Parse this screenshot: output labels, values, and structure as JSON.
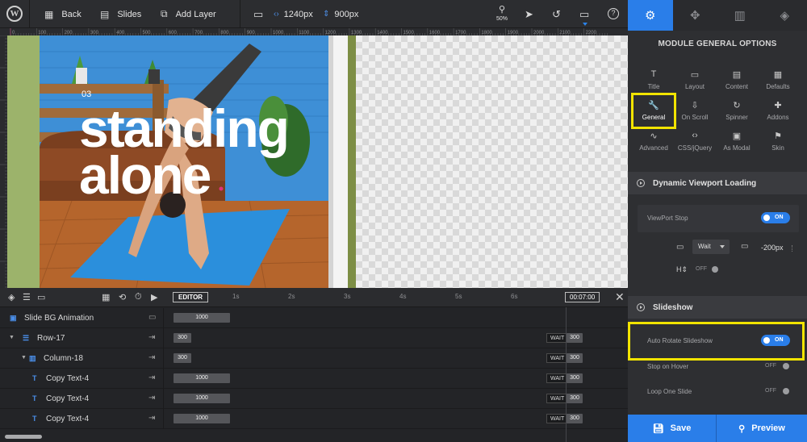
{
  "toolbar": {
    "wp_logo": "W",
    "back_label": "Back",
    "slides_label": "Slides",
    "add_layer_label": "Add Layer",
    "width_value": "1240px",
    "height_value": "900px",
    "zoom_label": "50%",
    "icons": [
      "wordpress-icon",
      "grid-icon",
      "slides-icon",
      "add-layer-icon",
      "monitor-icon",
      "width-arrows-icon",
      "height-arrows-icon",
      "search-icon",
      "cursor-icon",
      "undo-icon",
      "desktop-icon",
      "help-icon"
    ]
  },
  "right_panel": {
    "tabs": [
      {
        "icon": "gear-icon",
        "active": true
      },
      {
        "icon": "move-icon",
        "active": false
      },
      {
        "icon": "slides-grid-icon",
        "active": false
      },
      {
        "icon": "layers-icon",
        "active": false
      }
    ],
    "title": "MODULE GENERAL OPTIONS",
    "modules": [
      {
        "label": "Title",
        "glyph": "T"
      },
      {
        "label": "Layout",
        "glyph": "▭"
      },
      {
        "label": "Content",
        "glyph": "▤"
      },
      {
        "label": "Defaults",
        "glyph": "▦"
      },
      {
        "label": "General",
        "glyph": "🔧"
      },
      {
        "label": "On Scroll",
        "glyph": "⇩"
      },
      {
        "label": "Spinner",
        "glyph": "↻"
      },
      {
        "label": "Addons",
        "glyph": "✚"
      },
      {
        "label": "Advanced",
        "glyph": "∿"
      },
      {
        "label": "CSS/jQuery",
        "glyph": "‹›"
      },
      {
        "label": "As Modal",
        "glyph": "▣"
      },
      {
        "label": "Skin",
        "glyph": "⚑"
      }
    ],
    "dynamic_viewport": {
      "heading": "Dynamic Viewport Loading",
      "viewport_stop_label": "ViewPort Stop",
      "viewport_stop_value": "ON",
      "wait_select": "Wait",
      "offset_value": "-200px",
      "secondary_toggle": "OFF"
    },
    "slideshow": {
      "heading": "Slideshow",
      "auto_rotate_label": "Auto Rotate Slideshow",
      "auto_rotate_value": "ON",
      "stop_on_hover_label": "Stop on Hover",
      "stop_on_hover_value": "OFF",
      "loop_one_slide_label": "Loop One Slide",
      "loop_one_slide_value": "OFF"
    },
    "save_label": "Save",
    "preview_label": "Preview"
  },
  "ruler": {
    "marks": [
      "0",
      "100",
      "200",
      "300",
      "400",
      "500",
      "600",
      "700",
      "800",
      "900",
      "1000",
      "1100",
      "1200",
      "1300",
      "1400",
      "1500",
      "1600",
      "1700",
      "1800",
      "1900",
      "2000",
      "2100",
      "2200"
    ]
  },
  "slide": {
    "number": "03",
    "headline_line1": "standing",
    "headline_line2": "alone"
  },
  "timeline": {
    "editor_label": "EDITOR",
    "seconds": [
      "1s",
      "2s",
      "3s",
      "4s",
      "5s",
      "6s"
    ],
    "total_time": "00:07:00",
    "rows": [
      {
        "name": "Slide BG Animation",
        "bar": "1000",
        "wait": ""
      },
      {
        "name": "Row-17",
        "bar": "300",
        "wait": "WAIT",
        "wait_value": "300"
      },
      {
        "name": "Column-18",
        "bar": "300",
        "wait": "WAIT",
        "wait_value": "300"
      },
      {
        "name": "Copy Text-4",
        "bar": "1000",
        "wait": "WAIT",
        "wait_value": "300"
      },
      {
        "name": "Copy Text-4",
        "bar": "1000",
        "wait": "WAIT",
        "wait_value": "300"
      },
      {
        "name": "Copy Text-4",
        "bar": "1000",
        "wait": "WAIT",
        "wait_value": "300"
      }
    ]
  },
  "colors": {
    "accent": "#2a7ee9",
    "highlight": "#f2e400",
    "panel_bg": "#2e2f32",
    "toolbar_bg": "#2c2d30"
  }
}
